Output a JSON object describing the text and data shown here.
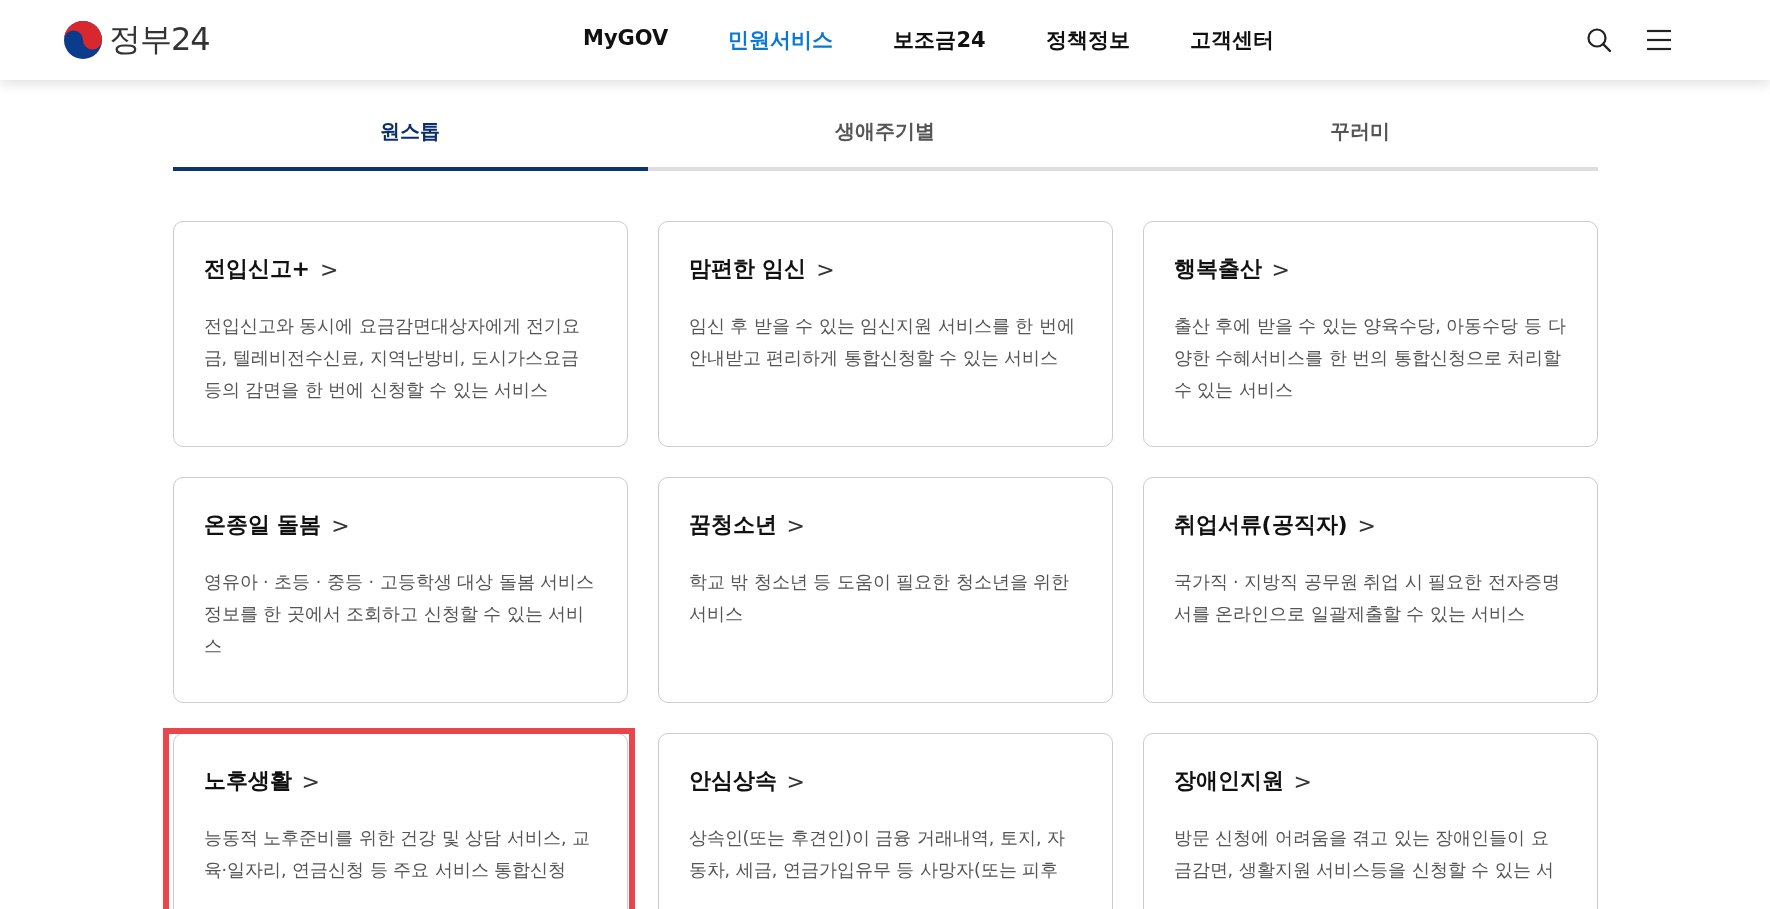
{
  "header": {
    "logo_text": "정부24",
    "nav": [
      {
        "label": "MyGOV",
        "selected": false
      },
      {
        "label": "민원서비스",
        "selected": true
      },
      {
        "label": "보조금24",
        "selected": false
      },
      {
        "label": "정책정보",
        "selected": false
      },
      {
        "label": "고객센터",
        "selected": false
      }
    ]
  },
  "tabs": [
    {
      "label": "원스톱",
      "selected": true
    },
    {
      "label": "생애주기별",
      "selected": false
    },
    {
      "label": "꾸러미",
      "selected": false
    }
  ],
  "cards": [
    {
      "title": "전입신고+",
      "chevron": ">",
      "description": "전입신고와 동시에 요금감면대상자에게 전기요금, 텔레비전수신료, 지역난방비, 도시가스요금 등의 감면을 한 번에 신청할 수 있는 서비스",
      "highlighted": false
    },
    {
      "title": "맘편한 임신",
      "chevron": ">",
      "description": "임신 후 받을 수 있는 임신지원 서비스를 한 번에 안내받고 편리하게 통합신청할 수 있는 서비스",
      "highlighted": false
    },
    {
      "title": "행복출산",
      "chevron": ">",
      "description": "출산 후에 받을 수 있는 양육수당, 아동수당 등 다양한 수혜서비스를 한 번의 통합신청으로 처리할 수 있는 서비스",
      "highlighted": false
    },
    {
      "title": "온종일 돌봄",
      "chevron": ">",
      "description": "영유아 · 초등 · 중등 · 고등학생 대상 돌봄 서비스 정보를 한 곳에서 조회하고 신청할 수 있는 서비스",
      "highlighted": false
    },
    {
      "title": "꿈청소년",
      "chevron": ">",
      "description": "학교 밖 청소년 등 도움이 필요한 청소년을 위한 서비스",
      "highlighted": false
    },
    {
      "title": "취업서류(공직자)",
      "chevron": ">",
      "description": "국가직 · 지방직 공무원 취업 시 필요한 전자증명서를 온라인으로 일괄제출할 수 있는 서비스",
      "highlighted": false
    },
    {
      "title": "노후생활",
      "chevron": ">",
      "description": "능동적 노후준비를 위한 건강 및 상담 서비스, 교육·일자리, 연금신청 등 주요 서비스 통합신청",
      "highlighted": true
    },
    {
      "title": "안심상속",
      "chevron": ">",
      "description": "상속인(또는 후견인)이 금융 거래내역, 토지, 자동차, 세금, 연금가입유무 등 사망자(또는 피후",
      "highlighted": false
    },
    {
      "title": "장애인지원",
      "chevron": ">",
      "description": "방문 신청에 어려움을 겪고 있는 장애인들이 요금감면, 생활지원 서비스등을 신청할 수 있는 서",
      "highlighted": false
    }
  ]
}
